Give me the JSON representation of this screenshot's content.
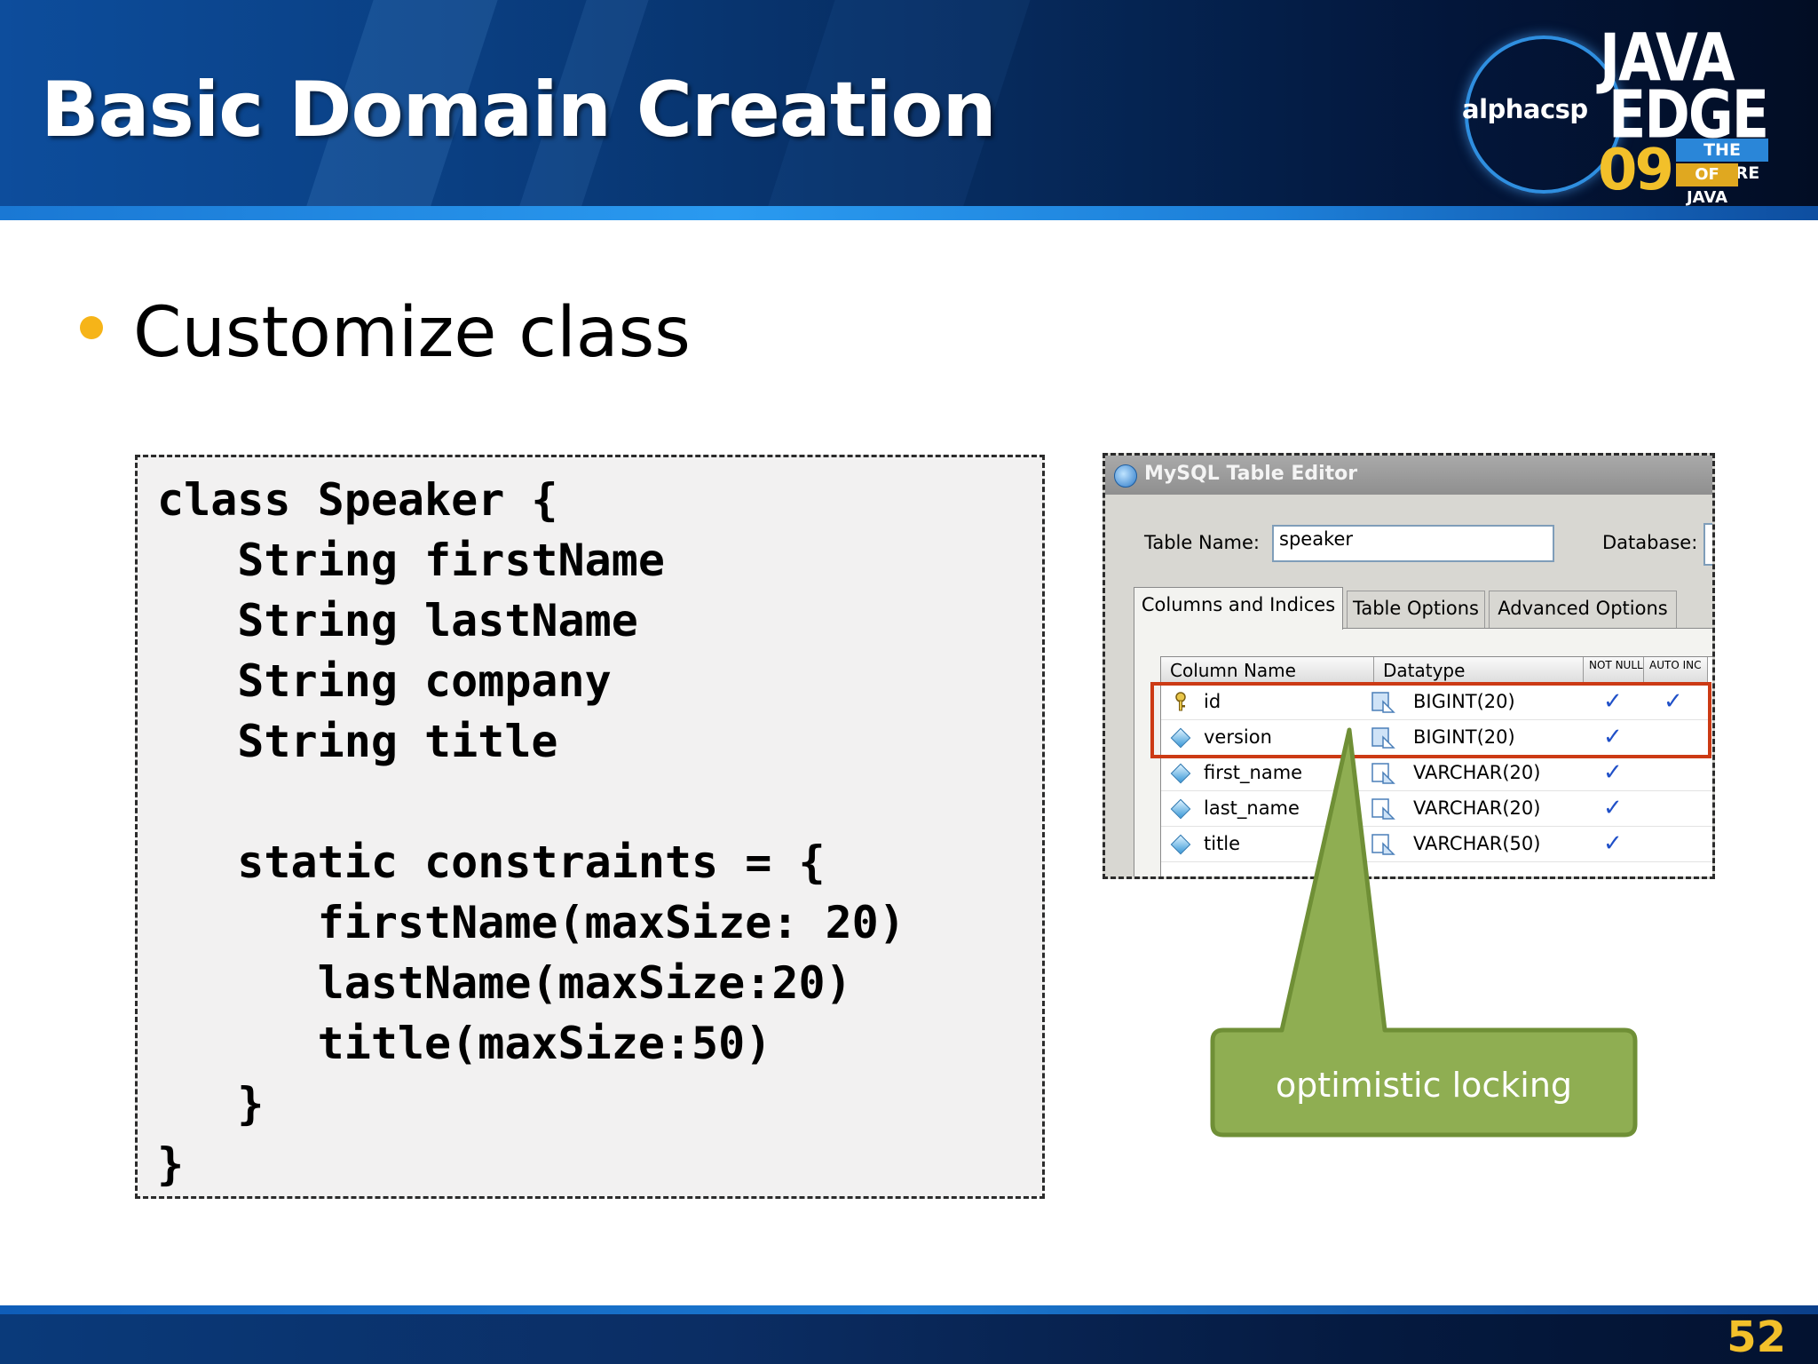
{
  "slide": {
    "title": "Basic Domain Creation",
    "bullet": "Customize class",
    "page_number": "52"
  },
  "logo": {
    "brand": "alphacsp",
    "line1": "JAVA",
    "line2": "EDGE",
    "year": "09",
    "tagline1": "THE FUTURE",
    "tagline2": "OF JAVA"
  },
  "code": {
    "text": "class Speaker {\n   String firstName\n   String lastName\n   String company\n   String title\n\n   static constraints = {\n      firstName(maxSize: 20)\n      lastName(maxSize:20)\n      title(maxSize:50)\n   }\n}"
  },
  "editor": {
    "window_title": "MySQL Table Editor",
    "table_name_label": "Table Name:",
    "table_name_value": "speaker",
    "database_label": "Database:",
    "tabs": [
      {
        "label": "Columns and Indices",
        "active": true
      },
      {
        "label": "Table Options",
        "active": false
      },
      {
        "label": "Advanced Options",
        "active": false
      }
    ],
    "columns": {
      "name": "Column Name",
      "datatype": "Datatype",
      "not_null": "NOT NULL",
      "auto_inc": "AUTO INC"
    },
    "rows": [
      {
        "name": "id",
        "datatype": "BIGINT(20)",
        "not_null": "✓",
        "auto_inc": "✓",
        "icon": "primary-key-icon"
      },
      {
        "name": "version",
        "datatype": "BIGINT(20)",
        "not_null": "✓",
        "auto_inc": "",
        "icon": "column-diamond-icon"
      },
      {
        "name": "first_name",
        "datatype": "VARCHAR(20)",
        "not_null": "✓",
        "auto_inc": "",
        "icon": "column-diamond-icon"
      },
      {
        "name": "last_name",
        "datatype": "VARCHAR(20)",
        "not_null": "✓",
        "auto_inc": "",
        "icon": "column-diamond-icon"
      },
      {
        "name": "title",
        "datatype": "VARCHAR(50)",
        "not_null": "✓",
        "auto_inc": "",
        "icon": "column-diamond-icon"
      }
    ]
  },
  "callout": {
    "text": "optimistic locking"
  },
  "colors": {
    "header_blue": "#0d4d9c",
    "bullet_yellow": "#f6b418",
    "callout_green": "#8fae52",
    "callout_border": "#6f8f36",
    "highlight_red": "#cc3a14",
    "page_number": "#f2c02a"
  }
}
